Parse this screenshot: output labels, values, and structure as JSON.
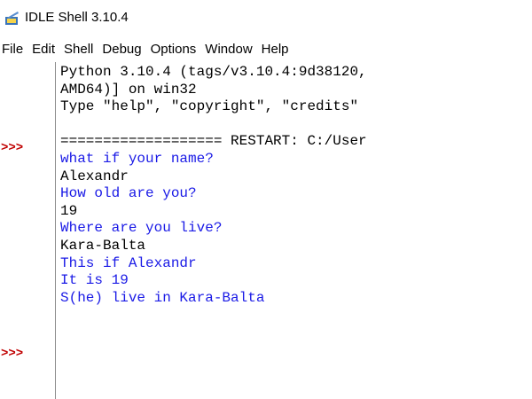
{
  "window": {
    "title": "IDLE Shell 3.10.4",
    "icon": "idle-feather-icon"
  },
  "menu": {
    "items": [
      {
        "label": "File"
      },
      {
        "label": "Edit"
      },
      {
        "label": "Shell"
      },
      {
        "label": "Debug"
      },
      {
        "label": "Options"
      },
      {
        "label": "Window"
      },
      {
        "label": "Help"
      }
    ]
  },
  "prompts": [
    ">>>",
    ">>>"
  ],
  "shell": {
    "lines": [
      {
        "text": "Python 3.10.4 (tags/v3.10.4:9d38120,",
        "kind": "banner"
      },
      {
        "text": "AMD64)] on win32",
        "kind": "banner"
      },
      {
        "text": "Type \"help\", \"copyright\", \"credits\"",
        "kind": "banner"
      },
      {
        "text": "",
        "kind": "banner"
      },
      {
        "text": "=================== RESTART: C:/User",
        "kind": "banner"
      },
      {
        "text": "what if your name?",
        "kind": "stdout"
      },
      {
        "text": "Alexandr",
        "kind": "stdin"
      },
      {
        "text": "How old are you?",
        "kind": "stdout"
      },
      {
        "text": "19",
        "kind": "stdin"
      },
      {
        "text": "Where are you live?",
        "kind": "stdout"
      },
      {
        "text": "Kara-Balta",
        "kind": "stdin"
      },
      {
        "text": "This if Alexandr",
        "kind": "stdout"
      },
      {
        "text": "It is 19",
        "kind": "stdout"
      },
      {
        "text": "S(he) live in Kara-Balta",
        "kind": "stdout"
      }
    ]
  },
  "colors": {
    "stdout": "#1a1ae6",
    "stdin": "#000000",
    "prompt": "#c00000"
  }
}
